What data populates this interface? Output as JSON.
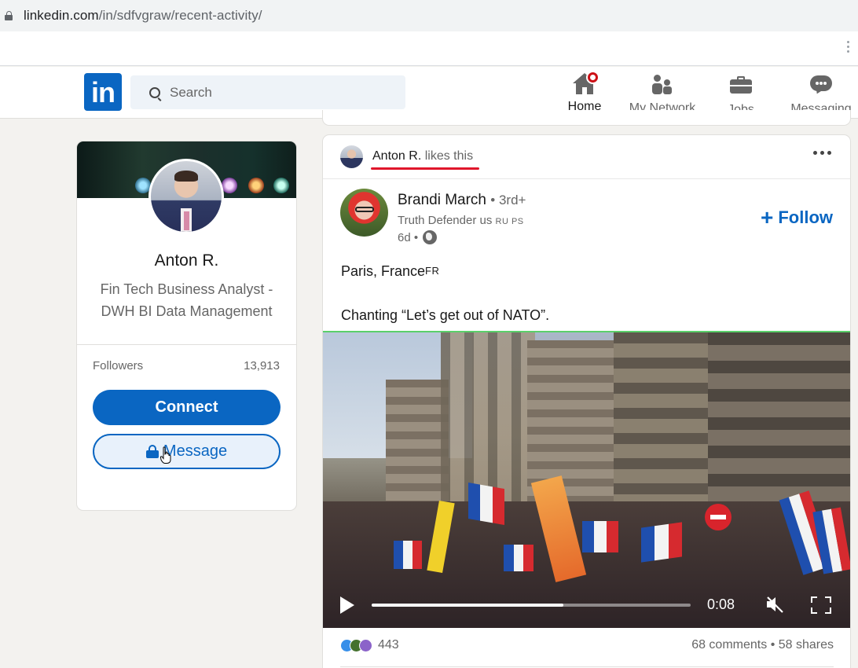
{
  "browser": {
    "url_host": "linkedin.com",
    "url_path": "/in/sdfvgraw/recent-activity/"
  },
  "header": {
    "logo": "in",
    "search_placeholder": "Search",
    "nav": [
      {
        "label": "Home",
        "icon": "home-icon",
        "has_notification": true
      },
      {
        "label": "My Network",
        "icon": "people-icon"
      },
      {
        "label": "Jobs",
        "icon": "briefcase-icon"
      },
      {
        "label": "Messaging",
        "icon": "chat-bubble-icon"
      }
    ]
  },
  "profile": {
    "name": "Anton R.",
    "headline": "Fin Tech Business Analyst - DWH BI Data Management",
    "followers_label": "Followers",
    "followers_count": "13,913",
    "connect_label": "Connect",
    "message_label": "Message"
  },
  "post": {
    "activity_actor": "Anton R.",
    "activity_text": "likes this",
    "author": {
      "name": "Brandi March",
      "degree": "• 3rd+",
      "headline": "Truth Defender us",
      "headline_flags": "RU PS",
      "time": "6d •"
    },
    "follow_label": "Follow",
    "text_lines": [
      {
        "text": "Paris, France",
        "flag": "FR"
      },
      {
        "text": "Chanting “Let’s get out of NATO”."
      }
    ],
    "video": {
      "time": "0:08",
      "progress_fraction": 0.6,
      "muted": true
    },
    "reactions_count": "443",
    "comments": "68 comments",
    "shares": "58 shares"
  },
  "colors": {
    "brand": "#0a66c2",
    "highlight_underline": "#e0162b",
    "notification": "#cc1016"
  }
}
